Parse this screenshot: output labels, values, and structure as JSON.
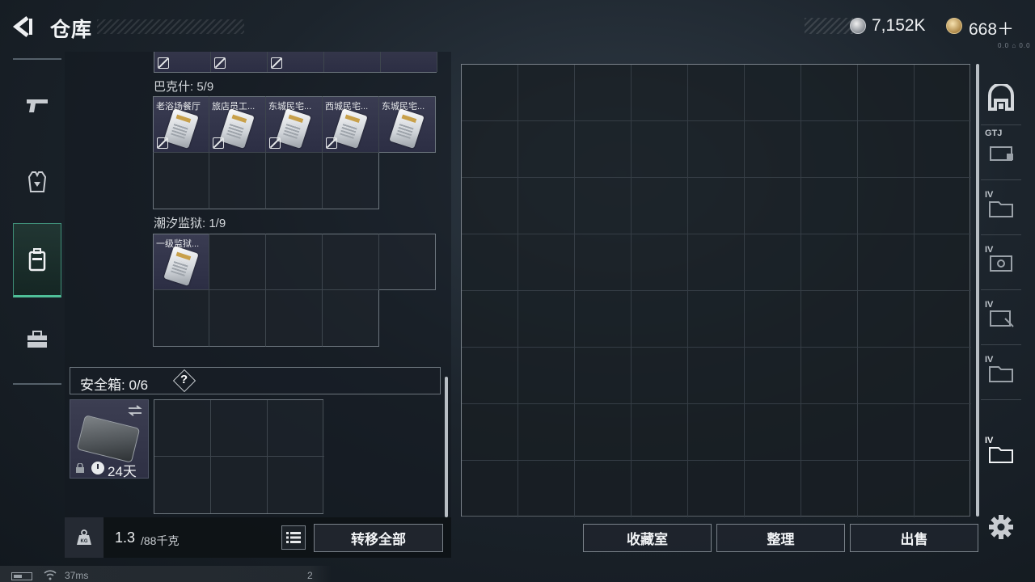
{
  "header": {
    "title": "仓库",
    "silver_amount": "7,152K",
    "gold_amount": "668＋",
    "version": "0.0 ⌂ 0.0"
  },
  "sidebar": {
    "tabs": [
      {
        "name": "weapons",
        "icon": "pistol-icon",
        "active": false
      },
      {
        "name": "armor",
        "icon": "vest-icon",
        "active": false
      },
      {
        "name": "backpack",
        "icon": "backpack-icon",
        "active": true
      },
      {
        "name": "cases",
        "icon": "briefcase-icon",
        "active": false
      }
    ]
  },
  "sections": [
    {
      "label": "巴克什: 5/9",
      "items": [
        "老浴场餐厅",
        "旅店员工...",
        "东城民宅...",
        "西城民宅...",
        "东城民宅..."
      ]
    },
    {
      "label": "潮汐监狱: 1/9",
      "items": [
        "一级监狱..."
      ]
    }
  ],
  "safe_box": {
    "label": "安全箱: 0/6",
    "help": "?",
    "days_left": "24天"
  },
  "weight": {
    "current": "1.3",
    "max": "/88千克"
  },
  "buttons": {
    "transfer_all": "转移全部",
    "collection_room": "收藏室",
    "organize": "整理",
    "sell": "出售"
  },
  "right_sidebar": {
    "tags": [
      "",
      "GTJ",
      "IV",
      "IV",
      "IV",
      "IV",
      "IV"
    ]
  },
  "status": {
    "ping": "37ms",
    "count": "2"
  },
  "colors": {
    "accent_green": "#4fbf98",
    "item_bg": "#34364a",
    "border": "#6c757d"
  }
}
